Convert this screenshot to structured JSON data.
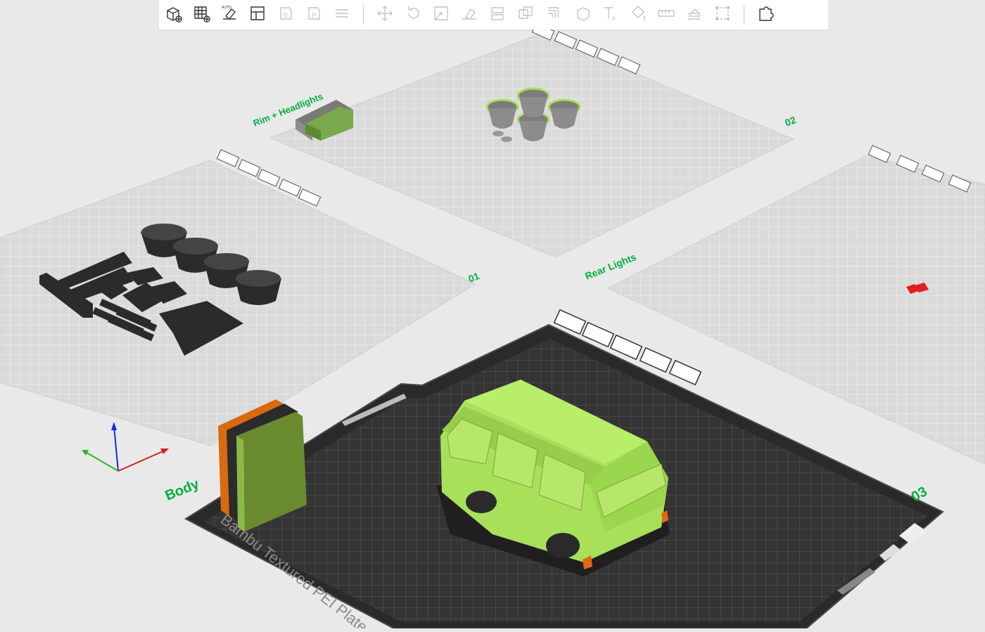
{
  "toolbar": {
    "buttons": [
      {
        "name": "add-object-button",
        "icon": "cube-plus-icon",
        "enabled": true
      },
      {
        "name": "add-plate-button",
        "icon": "grid-plus-icon",
        "enabled": true
      },
      {
        "name": "auto-orient-button",
        "icon": "auto-orient-icon",
        "enabled": true
      },
      {
        "name": "arrange-button",
        "icon": "arrange-icon",
        "enabled": true
      },
      {
        "name": "slice-plate-button",
        "icon": "plate-0-icon",
        "enabled": false
      },
      {
        "name": "print-plate-button",
        "icon": "plate-p-icon",
        "enabled": false
      },
      {
        "name": "layers-button",
        "icon": "layers-icon",
        "enabled": false
      },
      {
        "sep": true
      },
      {
        "name": "move-button",
        "icon": "move-icon",
        "enabled": false
      },
      {
        "name": "rotate-button",
        "icon": "rotate-icon",
        "enabled": false
      },
      {
        "name": "scale-button",
        "icon": "scale-icon",
        "enabled": false
      },
      {
        "name": "lay-on-face-button",
        "icon": "lay-face-icon",
        "enabled": false
      },
      {
        "name": "cut-button",
        "icon": "cut-icon",
        "enabled": false
      },
      {
        "name": "boolean-button",
        "icon": "boolean-icon",
        "enabled": false
      },
      {
        "name": "support-paint-button",
        "icon": "support-paint-icon",
        "enabled": false
      },
      {
        "name": "seam-paint-button",
        "icon": "seam-icon",
        "enabled": false
      },
      {
        "name": "text-tool-button",
        "icon": "text-icon",
        "enabled": false
      },
      {
        "name": "color-paint-button",
        "icon": "paint-bucket-icon",
        "enabled": false
      },
      {
        "name": "measure-button",
        "icon": "ruler-icon",
        "enabled": false
      },
      {
        "name": "assembly-button",
        "icon": "assembly-icon",
        "enabled": false
      },
      {
        "name": "simplify-button",
        "icon": "mesh-icon",
        "enabled": false
      },
      {
        "sep": true
      },
      {
        "name": "assembly-view-button",
        "icon": "puzzle-icon",
        "enabled": true
      }
    ]
  },
  "plates": [
    {
      "name": "plate-01",
      "number": "01",
      "label": "",
      "active": false
    },
    {
      "name": "plate-02",
      "number": "02",
      "label": "Rim + Headlights",
      "active": false
    },
    {
      "name": "plate-03",
      "number": "03",
      "label": "Body",
      "active": false
    },
    {
      "name": "plate-04",
      "number": "",
      "label": "Rear Lights",
      "active": false
    },
    {
      "name": "plate-active",
      "number": "03",
      "label": "Body",
      "active": true
    }
  ],
  "active_plate": {
    "bed_label": "Bambu Textured PEI Plate"
  },
  "colors": {
    "accent": "#00ae42",
    "model_green": "#a8e05a",
    "dark_part": "#2b2b2b",
    "rear_light": "#e02020",
    "bed_dark": "#2e2e2e",
    "inactive_bed": "#dddddd"
  }
}
